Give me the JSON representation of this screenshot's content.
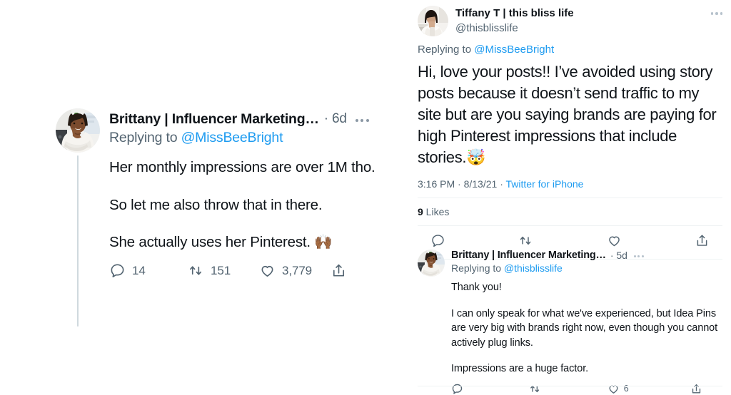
{
  "theme": {
    "background": "#ffffff",
    "text_primary": "#0f1419",
    "text_secondary": "#536471",
    "link_blue": "#1d9bf0",
    "divider": "#eff3f4",
    "thread_line": "#cfd9de"
  },
  "left_tweet": {
    "author_name": "Brittany | Influencer Marketing…",
    "timestamp": "· 6d",
    "replying_prefix": "Replying to ",
    "replying_handle": "@MissBeeBright",
    "paragraphs": [
      "Her monthly impressions are over 1M tho.",
      "So let me also throw that in there.",
      "She actually uses her Pinterest. 🙌🏾"
    ],
    "actions": {
      "reply_count": "14",
      "retweet_count": "151",
      "like_count": "3,779",
      "share_label": ""
    },
    "icons": {
      "reply": "reply-icon",
      "retweet": "retweet-icon",
      "like": "like-icon",
      "share": "share-icon",
      "more": "more-options-icon"
    }
  },
  "right_main_tweet": {
    "author_name": "Tiffany T | this bliss life",
    "author_handle": "@thisblisslife",
    "replying_prefix": "Replying to ",
    "replying_handle": "@MissBeeBright",
    "body": "Hi, love your posts!! I’ve avoided using story posts because it doesn’t send traffic to my site but are you saying brands are paying for high Pinterest  impressions that include stories.🤯",
    "time": "3:16 PM",
    "sep1": " · ",
    "date": "8/13/21",
    "sep2": " · ",
    "source": "Twitter for iPhone",
    "likes_count": "9",
    "likes_label": " Likes",
    "icons": {
      "reply": "reply-icon",
      "retweet": "retweet-icon",
      "like": "like-icon",
      "share": "share-icon",
      "more": "more-options-icon"
    }
  },
  "right_reply_tweet": {
    "author_name": "Brittany | Influencer Marketing…",
    "timestamp": "· 5d",
    "replying_prefix": "Replying to ",
    "replying_handle": "@thisblisslife",
    "paragraphs": [
      "Thank you!",
      "I can only speak for what we've experienced, but Idea Pins are very big with brands right now, even though you cannot actively plug links.",
      "Impressions are a huge factor."
    ],
    "actions": {
      "reply_count": "",
      "retweet_count": "",
      "like_count": "6",
      "share_label": ""
    },
    "icons": {
      "reply": "reply-icon",
      "retweet": "retweet-icon",
      "like": "like-icon",
      "share": "share-icon",
      "more": "more-options-icon"
    }
  }
}
